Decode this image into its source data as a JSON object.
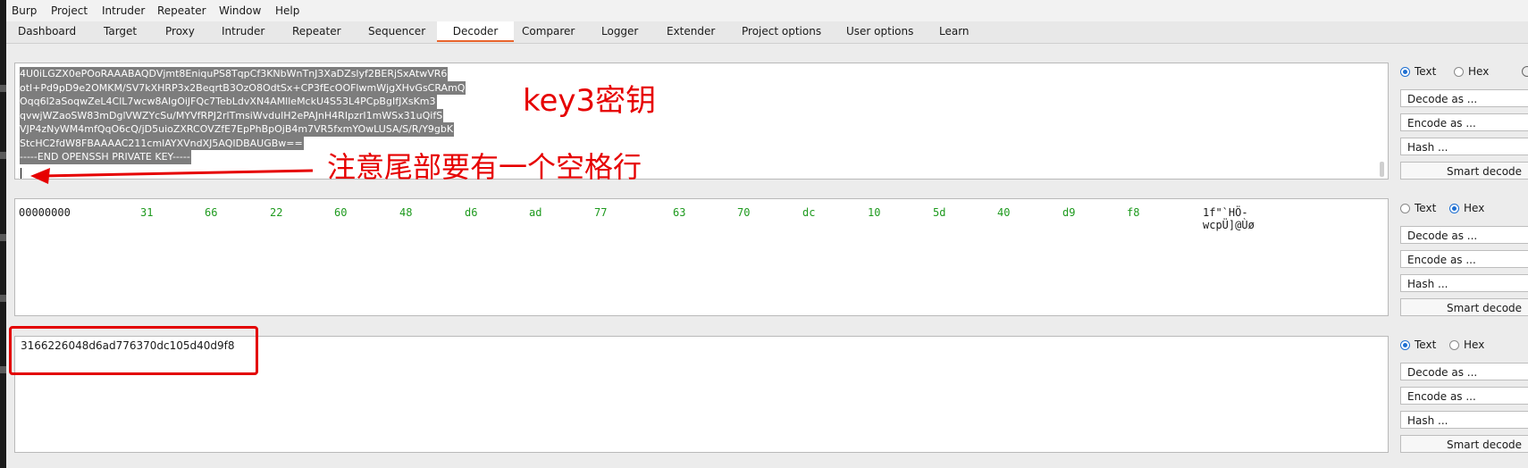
{
  "menu": [
    "Burp",
    "Project",
    "Intruder",
    "Repeater",
    "Window",
    "Help"
  ],
  "tabs": [
    "Dashboard",
    "Target",
    "Proxy",
    "Intruder",
    "Repeater",
    "Sequencer",
    "Decoder",
    "Comparer",
    "Logger",
    "Extender",
    "Project options",
    "User options",
    "Learn"
  ],
  "active_tab": "Decoder",
  "accent_color": "#e8642c",
  "panel1": {
    "lines": [
      "4U0iLGZX0ePOoRAAABAQDVjmt8EniquPS8TqpCf3KNbWnTnJ3XaDZslyf2BERjSxAtwVR6",
      "otl+Pd9pD9e2OMKM/SV7kXHRP3x2BeqrtB3OzO8OdtSx+CP3fEcOOFlwmWjgXHvGsCRAmQ",
      "Oqq6l2aSoqwZeL4ClL7wcw8AIgOiJFQc7TebLdvXN4AMlleMckU4S53L4PCpBgIfJXsKm3",
      "qvwjWZaoSW83mDglVWZYcSu/MYVfRPJ2rlTmsiWvdulH2ePAJnH4RIpzrI1mWSx31uQifS",
      "VJP4zNyWM4mfQqO6cQ/jD5uioZXRCOVZfE7EpPhBpOjB4m7VR5fxmYOwLUSA/S/R/Y9gbK",
      "StcHC2fdW8FBAAAAC211cmlAYXVndXJ5AQIDBAUGBw==",
      "-----END OPENSSH PRIVATE KEY-----"
    ],
    "annotation_key": "key3密钥",
    "annotation_note": "注意尾部要有一个空格行"
  },
  "panel2": {
    "offset": "00000000",
    "bytes": [
      "31",
      "66",
      "22",
      "60",
      "48",
      "d6",
      "ad",
      "77",
      "63",
      "70",
      "dc",
      "10",
      "5d",
      "40",
      "d9",
      "f8"
    ],
    "ascii": "1f\"`HÖ-wcpÜ\u0010]@Ùø"
  },
  "panel3": {
    "text": "3166226048d6ad776370dc105d40d9f8"
  },
  "sidebars": [
    {
      "text_label": "Text",
      "hex_label": "Hex",
      "selected": "Text",
      "decode": "Decode as ...",
      "encode": "Encode as ...",
      "hash": "Hash ...",
      "smart": "Smart decode"
    },
    {
      "text_label": "Text",
      "hex_label": "Hex",
      "selected": "Hex",
      "decode": "Decode as ...",
      "encode": "Encode as ...",
      "hash": "Hash ...",
      "smart": "Smart decode"
    },
    {
      "text_label": "Text",
      "hex_label": "Hex",
      "selected": "Text",
      "decode": "Decode as ...",
      "encode": "Encode as ...",
      "hash": "Hash ...",
      "smart": "Smart decode"
    }
  ]
}
